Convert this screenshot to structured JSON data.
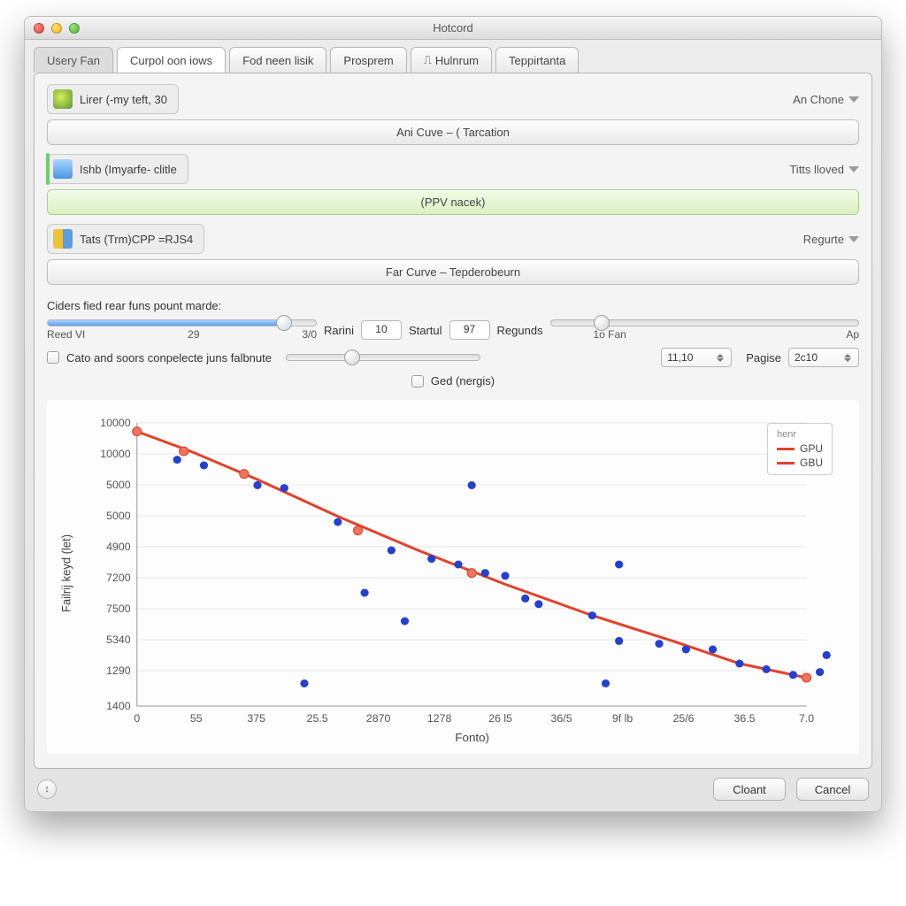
{
  "window": {
    "title": "Hotcord"
  },
  "tabs": [
    {
      "label": "Usery Fan"
    },
    {
      "label": "Curpol oon iows",
      "active": true
    },
    {
      "label": "Fod neen lisik"
    },
    {
      "label": "Prosprem"
    },
    {
      "label_prefix": "⎍",
      "label": "Hulnrum"
    },
    {
      "label": "Teppirtanta"
    }
  ],
  "sections": [
    {
      "chip_label": "Lirer (-my teft, 30",
      "right_label": "An Chone",
      "button_label": "Ani Cuve – ( Tarcation",
      "icon": "a"
    },
    {
      "chip_label": "Ishb (Imyarfe- clitle",
      "right_label": "Titts lloved",
      "button_label": "(PPV nacek)",
      "button_green": true,
      "icon": "b",
      "chip_green": true
    },
    {
      "chip_label": "Tats (Trm)CPP =RJS4",
      "right_label": "Regurte",
      "button_label": "Far Curve – Tepderobeurn",
      "icon": "c"
    }
  ],
  "controls": {
    "title": "Ciders fied rear funs pount marde:",
    "slider1": {
      "ticks": [
        "Reed VI",
        "29",
        "3/0"
      ],
      "fill_percent": 88
    },
    "field1": {
      "label": "Rarini",
      "value": "10"
    },
    "field2": {
      "label": "Startul",
      "value": "97"
    },
    "slider2": {
      "label": "Regunds",
      "ticks_left": "1o Fan",
      "ticks_right": "Ap",
      "pos": 14
    },
    "checkbox1_label": "Cato and soors conpelecte juns falbnute",
    "slider3_pos": 30,
    "spin1_value": "11,10",
    "pagise_label": "Pagise",
    "pagise_value": "2c10",
    "checkbox2_label": "Ged (nergis)"
  },
  "chart_data": {
    "type": "scatter+line",
    "title": "",
    "ylabel": "Failrij keyd (let)",
    "xlabel": "Fonto)",
    "y_ticks": [
      "10000",
      "10000",
      "5000",
      "5000",
      "4900",
      "7200",
      "7500",
      "5340",
      "1290",
      "1400"
    ],
    "x_ticks": [
      "0",
      "55",
      "375",
      "25.5",
      "2870",
      "1278",
      "26 l5",
      "36/5",
      "9f lb",
      "25/6",
      "36.5",
      "7.0"
    ],
    "line_series_norm": [
      {
        "x": 0.0,
        "y": 0.97
      },
      {
        "x": 0.08,
        "y": 0.9
      },
      {
        "x": 0.18,
        "y": 0.8
      },
      {
        "x": 0.3,
        "y": 0.67
      },
      {
        "x": 0.42,
        "y": 0.55
      },
      {
        "x": 0.55,
        "y": 0.43
      },
      {
        "x": 0.68,
        "y": 0.32
      },
      {
        "x": 0.8,
        "y": 0.23
      },
      {
        "x": 0.9,
        "y": 0.15
      },
      {
        "x": 1.0,
        "y": 0.1
      }
    ],
    "line_markers_norm": [
      {
        "x": 0.0,
        "y": 0.97
      },
      {
        "x": 0.07,
        "y": 0.9
      },
      {
        "x": 0.16,
        "y": 0.82
      },
      {
        "x": 0.33,
        "y": 0.62
      },
      {
        "x": 0.5,
        "y": 0.47
      },
      {
        "x": 1.0,
        "y": 0.1
      }
    ],
    "scatter_norm": [
      {
        "x": 0.06,
        "y": 0.87
      },
      {
        "x": 0.1,
        "y": 0.85
      },
      {
        "x": 0.18,
        "y": 0.78
      },
      {
        "x": 0.22,
        "y": 0.77
      },
      {
        "x": 0.3,
        "y": 0.65
      },
      {
        "x": 0.34,
        "y": 0.4
      },
      {
        "x": 0.38,
        "y": 0.55
      },
      {
        "x": 0.4,
        "y": 0.3
      },
      {
        "x": 0.44,
        "y": 0.52
      },
      {
        "x": 0.48,
        "y": 0.5
      },
      {
        "x": 0.5,
        "y": 0.78
      },
      {
        "x": 0.52,
        "y": 0.47
      },
      {
        "x": 0.55,
        "y": 0.46
      },
      {
        "x": 0.58,
        "y": 0.38
      },
      {
        "x": 0.6,
        "y": 0.36
      },
      {
        "x": 0.25,
        "y": 0.08
      },
      {
        "x": 0.68,
        "y": 0.32
      },
      {
        "x": 0.7,
        "y": 0.08
      },
      {
        "x": 0.72,
        "y": 0.23
      },
      {
        "x": 0.72,
        "y": 0.5
      },
      {
        "x": 0.78,
        "y": 0.22
      },
      {
        "x": 0.82,
        "y": 0.2
      },
      {
        "x": 0.86,
        "y": 0.2
      },
      {
        "x": 0.9,
        "y": 0.15
      },
      {
        "x": 0.94,
        "y": 0.13
      },
      {
        "x": 0.98,
        "y": 0.11
      },
      {
        "x": 1.02,
        "y": 0.12
      },
      {
        "x": 1.03,
        "y": 0.18
      }
    ],
    "legend": {
      "header": "henr",
      "items": [
        "GPU",
        "GBU"
      ]
    }
  },
  "footer": {
    "left_button": "↕",
    "button1": "Cloant",
    "button2": "Cancel"
  }
}
